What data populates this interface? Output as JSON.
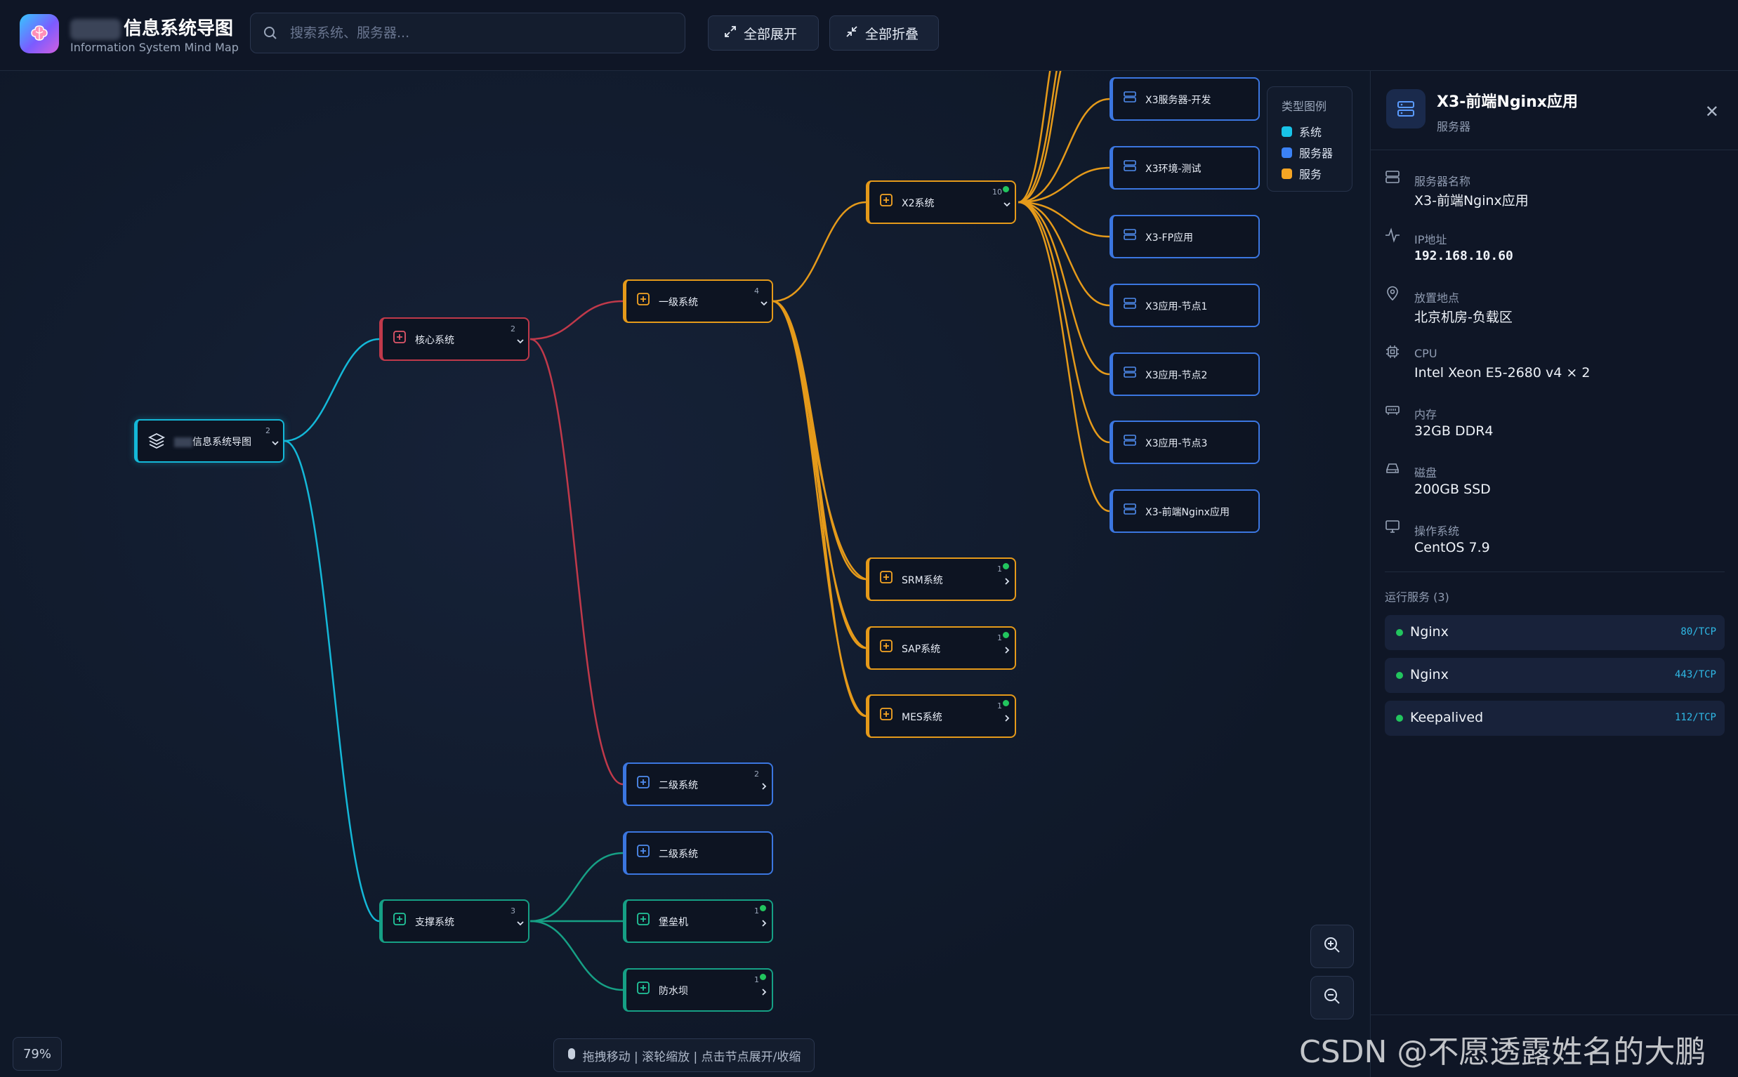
{
  "app": {
    "title": "信息系统导图",
    "subtitle": "Information System Mind Map"
  },
  "search": {
    "placeholder": "搜索系统、服务器..."
  },
  "toolbar": {
    "expand_label": "全部展开",
    "collapse_label": "全部折叠"
  },
  "colors": {
    "cyan": "#14b8d8",
    "red": "#c0394a",
    "orange": "#e59a1a",
    "blue": "#3b76e0",
    "green": "#16a085"
  },
  "nodes": {
    "root": {
      "label": "信息系统导图",
      "count": "2"
    },
    "core": {
      "label": "核心系统",
      "count": "2"
    },
    "support": {
      "label": "支撑系统",
      "count": "3"
    },
    "level1": {
      "label": "一级系统",
      "count": "4"
    },
    "level2a": {
      "label": "二级系统",
      "count": "2"
    },
    "level2b": {
      "label": "二级系统"
    },
    "bastion": {
      "label": "堡垒机",
      "count": "1"
    },
    "firewall": {
      "label": "防水坝",
      "count": "1"
    },
    "x2": {
      "label": "X2系统",
      "count": "10"
    },
    "srm": {
      "label": "SRM系统",
      "count": "1"
    },
    "sap": {
      "label": "SAP系统",
      "count": "1"
    },
    "mes": {
      "label": "MES系统",
      "count": "1"
    },
    "x3dev": {
      "label": "X3服务器-开发"
    },
    "x3test": {
      "label": "X3环境-测试"
    },
    "x3fp": {
      "label": "X3-FP应用"
    },
    "x3n1": {
      "label": "X3应用-节点1"
    },
    "x3n2": {
      "label": "X3应用-节点2"
    },
    "x3n3": {
      "label": "X3应用-节点3"
    },
    "x3nginx": {
      "label": "X3-前端Nginx应用"
    }
  },
  "legend": {
    "title": "类型图例",
    "items": [
      {
        "label": "系统",
        "color": "#18c3e8"
      },
      {
        "label": "服务器",
        "color": "#3b82f6"
      },
      {
        "label": "服务",
        "color": "#f5a524"
      }
    ]
  },
  "canvas": {
    "zoom": "79%",
    "hint": "拖拽移动 | 滚轮缩放 | 点击节点展开/收缩"
  },
  "panel": {
    "title": "X3-前端Nginx应用",
    "type": "服务器",
    "fields": [
      {
        "label": "服务器名称",
        "value": "X3-前端Nginx应用",
        "icon": "server-icon"
      },
      {
        "label": "IP地址",
        "value": "192.168.10.60",
        "icon": "activity-icon"
      },
      {
        "label": "放置地点",
        "value": "北京机房-负载区",
        "icon": "map-pin-icon"
      },
      {
        "label": "CPU",
        "value": "Intel Xeon E5-2680 v4 × 2",
        "icon": "cpu-icon"
      },
      {
        "label": "内存",
        "value": "32GB DDR4",
        "icon": "memory-icon"
      },
      {
        "label": "磁盘",
        "value": "200GB SSD",
        "icon": "disk-icon"
      },
      {
        "label": "操作系统",
        "value": "CentOS 7.9",
        "icon": "monitor-icon"
      }
    ],
    "services_title": "运行服务 (3)",
    "services": [
      {
        "name": "Nginx",
        "port": "80/TCP"
      },
      {
        "name": "Nginx",
        "port": "443/TCP"
      },
      {
        "name": "Keepalived",
        "port": "112/TCP"
      }
    ]
  },
  "watermark": "CSDN @不愿透露姓名的大鹏"
}
